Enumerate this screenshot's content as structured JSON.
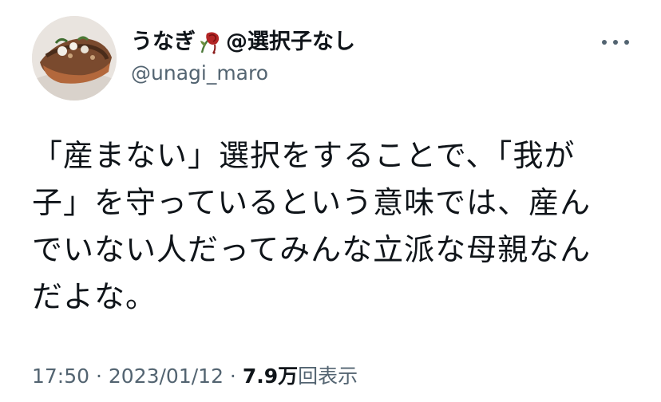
{
  "author": {
    "display_name_prefix": "うなぎ",
    "display_name_suffix": "@選択子なし",
    "handle": "@unagi_maro",
    "avatar_icon": "food-photo-avatar",
    "name_emoji_icon": "wilted-flower-icon"
  },
  "tweet": {
    "lines": [
      "「産まない」選択をすることで、「我が",
      "子」を守っているという意味では、産ん",
      "でいない人だってみんな立派な母親なん",
      "だよな。"
    ]
  },
  "meta": {
    "time": "17:50",
    "sep1": " · ",
    "date": "2023/01/12",
    "sep2": " · ",
    "views_count": "7.9万",
    "views_label": "回表示"
  },
  "colors": {
    "text_primary": "#0f1419",
    "text_secondary": "#536471"
  }
}
